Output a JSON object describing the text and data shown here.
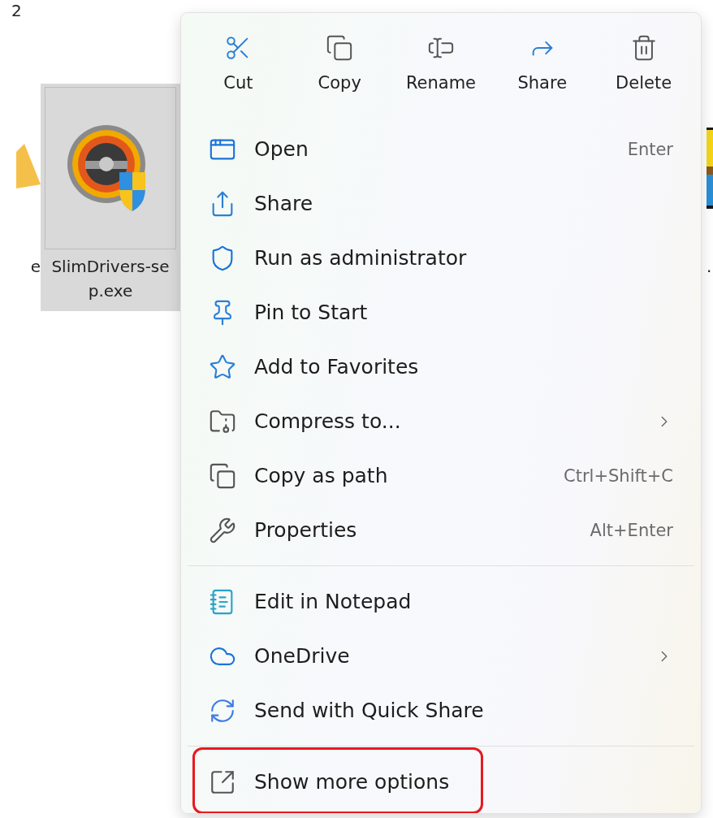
{
  "explorer": {
    "top_fragment": "2",
    "files": [
      {
        "kind": "folder",
        "label": [
          "e"
        ],
        "selected": false
      },
      {
        "kind": "app",
        "label": [
          "SlimDrivers-se",
          "p.exe"
        ],
        "selected": true
      },
      {
        "label": [
          "."
        ],
        "selected": false
      }
    ]
  },
  "context_menu": {
    "toolbar": [
      {
        "label": "Cut"
      },
      {
        "label": "Copy"
      },
      {
        "label": "Rename"
      },
      {
        "label": "Share"
      },
      {
        "label": "Delete"
      }
    ],
    "sections": [
      {
        "items": [
          {
            "label": "Open",
            "shortcut": "Enter",
            "submenu": false,
            "highlighted": false
          },
          {
            "label": "Share",
            "submenu": false,
            "highlighted": false
          },
          {
            "label": "Run as administrator",
            "submenu": false,
            "highlighted": false
          },
          {
            "label": "Pin to Start",
            "submenu": false,
            "highlighted": false
          },
          {
            "label": "Add to Favorites",
            "submenu": false,
            "highlighted": false
          },
          {
            "label": "Compress to...",
            "submenu": true,
            "highlighted": false
          },
          {
            "label": "Copy as path",
            "shortcut": "Ctrl+Shift+C",
            "submenu": false,
            "highlighted": false
          },
          {
            "label": "Properties",
            "shortcut": "Alt+Enter",
            "submenu": false,
            "highlighted": false
          }
        ]
      },
      {
        "items": [
          {
            "label": "Edit in Notepad",
            "submenu": false,
            "highlighted": false
          },
          {
            "label": "OneDrive",
            "submenu": true,
            "highlighted": false
          },
          {
            "label": "Send with Quick Share",
            "submenu": false,
            "highlighted": false
          }
        ]
      },
      {
        "items": [
          {
            "label": "Show more options",
            "submenu": false,
            "highlighted": true
          }
        ]
      }
    ]
  }
}
